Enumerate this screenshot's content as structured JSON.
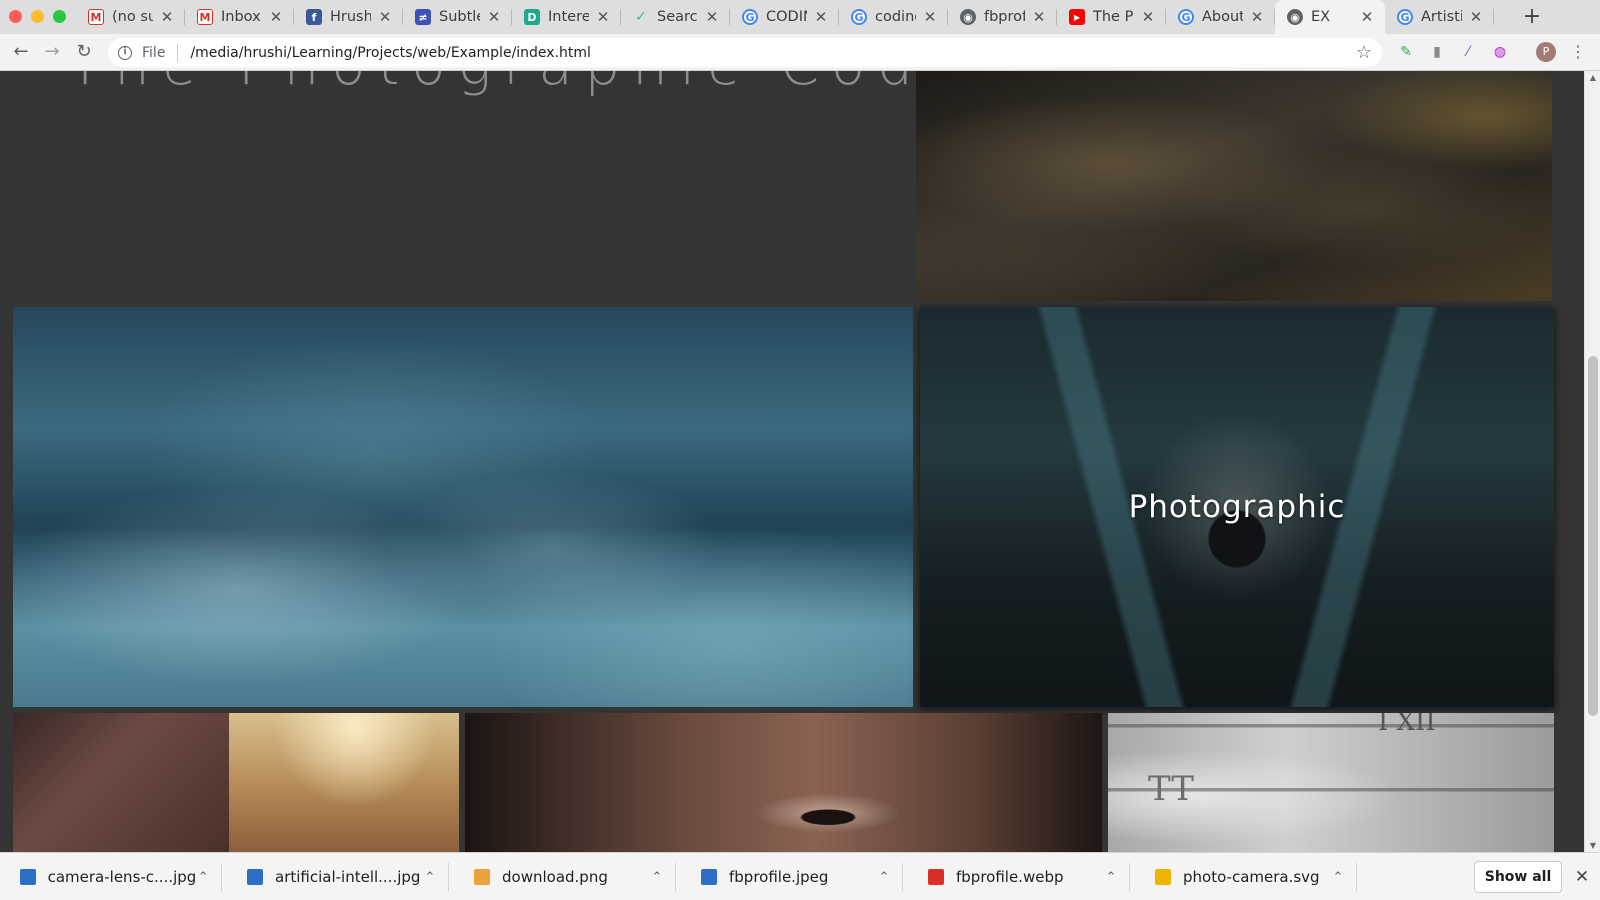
{
  "tabs": [
    {
      "title": "(no sul",
      "icon": "gmail-icon"
    },
    {
      "title": "Inbox -",
      "icon": "gmail-icon"
    },
    {
      "title": "Hrushi",
      "icon": "facebook-icon"
    },
    {
      "title": "Subtle",
      "icon": "subtle-icon"
    },
    {
      "title": "Interes",
      "icon": "d-icon"
    },
    {
      "title": "Search",
      "icon": "vue-icon"
    },
    {
      "title": "CODIN",
      "icon": "google-icon"
    },
    {
      "title": "coding",
      "icon": "google-icon"
    },
    {
      "title": "fbprof",
      "icon": "globe-icon"
    },
    {
      "title": "The Ph",
      "icon": "youtube-icon"
    },
    {
      "title": "About",
      "icon": "google-icon"
    },
    {
      "title": "EX",
      "icon": "globe-icon",
      "active": true
    },
    {
      "title": "Artisti",
      "icon": "google-icon"
    }
  ],
  "toolbar": {
    "scheme": "File",
    "url": "/media/hrushi/Learning/Projects/web/Example/index.html",
    "avatar_initial": "P"
  },
  "page": {
    "site_title": "The Photographic Coder",
    "overlay_caption": "Photographic",
    "wall_inscription_1": "TT",
    "wall_inscription_2": "I XII"
  },
  "downloads": [
    {
      "name": "camera-lens-c....jpg",
      "icon_color": "#2d6fc4"
    },
    {
      "name": "artificial-intell....jpg",
      "icon_color": "#2d6fc4"
    },
    {
      "name": "download.png",
      "icon_color": "#e8a33a"
    },
    {
      "name": "fbprofile.jpeg",
      "icon_color": "#2d6fc4"
    },
    {
      "name": "fbprofile.webp",
      "icon_color": "#d93025"
    },
    {
      "name": "photo-camera.svg",
      "icon_color": "#f0b400"
    }
  ],
  "shelf": {
    "show_all_label": "Show all"
  },
  "colors": {
    "page_background": "#343434",
    "chrome_background": "#dedede"
  }
}
